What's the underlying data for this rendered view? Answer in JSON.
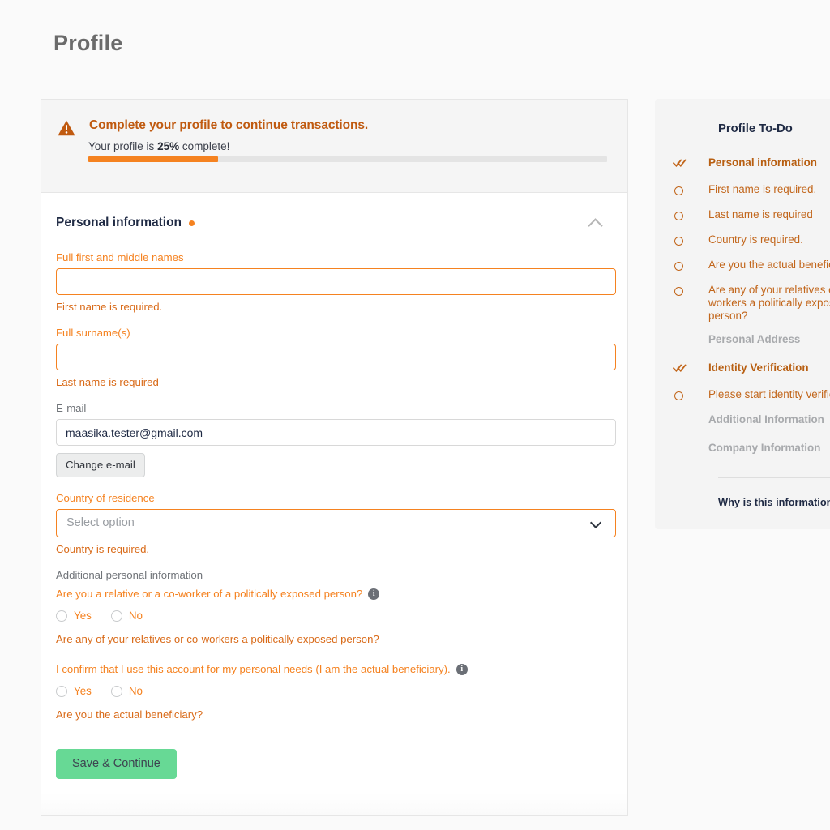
{
  "page": {
    "title": "Profile"
  },
  "alert": {
    "icon": "warning-triangle-icon",
    "title": "Complete your profile to continue transactions.",
    "subtitle_prefix": "Your profile is ",
    "subtitle_percent": "25%",
    "subtitle_suffix": " complete!",
    "progress_percent": 25
  },
  "section": {
    "title": "Personal information",
    "required_marker": "required-dot",
    "collapse_icon": "chevron-up-icon"
  },
  "fields": {
    "first_name": {
      "label": "Full first and middle names",
      "value": "",
      "placeholder": "",
      "error": "First name is required."
    },
    "surname": {
      "label": "Full surname(s)",
      "value": "",
      "placeholder": "",
      "error": "Last name is required"
    },
    "email": {
      "label": "E-mail",
      "value": "maasika.tester@gmail.com",
      "change_button": "Change e-mail"
    },
    "country": {
      "label": "Country of residence",
      "placeholder": "Select option",
      "value": "",
      "error": "Country is required.",
      "caret_icon": "chevron-down-icon"
    }
  },
  "additional": {
    "heading": "Additional personal information",
    "questions": [
      {
        "text": "Are you a relative or a co-worker of a politically exposed person?",
        "info_icon": "info-icon",
        "options": [
          "Yes",
          "No"
        ],
        "error": "Are any of your relatives or co-workers a politically exposed person?"
      },
      {
        "text": "I confirm that I use this account for my personal needs (I am the actual beneficiary).",
        "info_icon": "info-icon",
        "options": [
          "Yes",
          "No"
        ],
        "error": "Are you the actual beneficiary?"
      }
    ]
  },
  "submit": {
    "label": "Save & Continue"
  },
  "todo": {
    "title": "Profile To-Do",
    "items": [
      {
        "icon": "double-check-icon",
        "label": "Personal information",
        "style": "group"
      },
      {
        "icon": "circle-icon",
        "label": "First name is required.",
        "style": "task"
      },
      {
        "icon": "circle-icon",
        "label": "Last name is required",
        "style": "task"
      },
      {
        "icon": "circle-icon",
        "label": "Country is required.",
        "style": "task"
      },
      {
        "icon": "circle-icon",
        "label": "Are you the actual beneficiary?",
        "style": "task"
      },
      {
        "icon": "circle-icon",
        "label": "Are any of your relatives or co-workers a politically exposed person?",
        "style": "task-wrap"
      },
      {
        "icon": "none",
        "label": "Personal Address",
        "style": "muted"
      },
      {
        "icon": "double-check-icon",
        "label": "Identity Verification",
        "style": "group"
      },
      {
        "icon": "circle-icon",
        "label": "Please start identity verification",
        "style": "task"
      },
      {
        "icon": "none",
        "label": "Additional Information",
        "style": "muted"
      },
      {
        "icon": "none",
        "label": "Company Information",
        "style": "muted"
      }
    ],
    "link": "Why is this information needed?"
  },
  "colors": {
    "accent_orange": "#f58220",
    "alert_orange": "#c05a10",
    "todo_orange": "#c2661b",
    "green": "#67d995",
    "dark_navy": "#1f2a44",
    "muted_gray": "#a8aaad"
  }
}
